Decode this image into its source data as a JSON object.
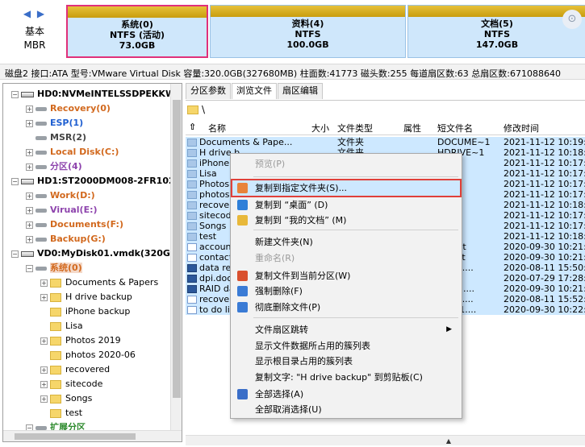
{
  "disk_map": {
    "nav_arrows": "◀ ▶",
    "disk_kind": "基本",
    "disk_style": "MBR",
    "partitions": [
      {
        "name": "系统(0)",
        "fs": "NTFS (活动)",
        "size": "73.0GB"
      },
      {
        "name": "资料(4)",
        "fs": "NTFS",
        "size": "100.0GB"
      },
      {
        "name": "文档(5)",
        "fs": "NTFS",
        "size": "147.0GB"
      }
    ],
    "highlight_color": "#e0307a"
  },
  "info_bar": "磁盘2 接口:ATA  型号:VMware Virtual Disk  容量:320.0GB(327680MB)  柱面数:41773  磁头数:255  每道扇区数:63  总扇区数:671088640",
  "tree": {
    "nodes": [
      {
        "label": "HD0:NVMeINTELSSDPEKKW2",
        "type": "disk",
        "exp": "−"
      },
      {
        "label": "Recovery(0)",
        "type": "part",
        "exp": "+"
      },
      {
        "label": "ESP(1)",
        "type": "part",
        "exp": "+"
      },
      {
        "label": "MSR(2)",
        "type": "part",
        "exp": ""
      },
      {
        "label": "Local Disk(C:)",
        "type": "part",
        "exp": "+"
      },
      {
        "label": "分区(4)",
        "type": "part",
        "exp": "+"
      },
      {
        "label": "HD1:ST2000DM008-2FR102(1",
        "type": "disk",
        "exp": "−"
      },
      {
        "label": "Work(D:)",
        "type": "part",
        "exp": "+"
      },
      {
        "label": "Virual(E:)",
        "type": "part",
        "exp": "+"
      },
      {
        "label": "Documents(F:)",
        "type": "part",
        "exp": "+"
      },
      {
        "label": "Backup(G:)",
        "type": "part",
        "exp": "+"
      },
      {
        "label": "VD0:MyDisk01.vmdk(320GB)",
        "type": "disk",
        "exp": "−"
      },
      {
        "label": "系统(0)",
        "type": "part",
        "exp": "−"
      },
      {
        "label": "Documents & Papers",
        "type": "folder",
        "exp": "+"
      },
      {
        "label": "H drive backup",
        "type": "folder",
        "exp": "+"
      },
      {
        "label": "iPhone backup",
        "type": "folder",
        "exp": ""
      },
      {
        "label": "Lisa",
        "type": "folder",
        "exp": ""
      },
      {
        "label": "Photos 2019",
        "type": "folder",
        "exp": "+"
      },
      {
        "label": "photos 2020-06",
        "type": "folder",
        "exp": ""
      },
      {
        "label": "recovered",
        "type": "folder",
        "exp": "+"
      },
      {
        "label": "sitecode",
        "type": "folder",
        "exp": "+"
      },
      {
        "label": "Songs",
        "type": "folder",
        "exp": "+"
      },
      {
        "label": "test",
        "type": "folder",
        "exp": ""
      },
      {
        "label": "扩展分区",
        "type": "part",
        "exp": "−"
      }
    ]
  },
  "tabs": [
    "分区参数",
    "浏览文件",
    "扇区编辑"
  ],
  "path": "\\",
  "columns": {
    "up": "⇧",
    "name": "名称",
    "size": "大小",
    "type": "文件类型",
    "attr": "属性",
    "short": "短文件名",
    "mtime": "修改时间"
  },
  "files": [
    {
      "name": "Documents & Pape...",
      "type": "文件夹",
      "attr": "",
      "short": "DOCUME~1",
      "mtime": "2021-11-12 10:19:2",
      "icon": "folder"
    },
    {
      "name": "H drive b...",
      "type": "文件夹",
      "attr": "",
      "short": "HDRIVE~1",
      "mtime": "2021-11-12 10:18:3",
      "icon": "folder"
    },
    {
      "name": "iPhone",
      "type": "",
      "attr": "",
      "short": "VE~1",
      "mtime": "2021-11-12 10:17:2",
      "icon": "folder"
    },
    {
      "name": "Lisa",
      "type": "",
      "attr": "",
      "short": "",
      "mtime": "2021-11-12 10:17:4",
      "icon": "folder"
    },
    {
      "name": "Photos",
      "type": "",
      "attr": "",
      "short": "OS~2",
      "mtime": "2021-11-12 10:17:2",
      "icon": "folder"
    },
    {
      "name": "photos",
      "type": "",
      "attr": "",
      "short": "OS~1",
      "mtime": "2021-11-12 10:17:2",
      "icon": "folder"
    },
    {
      "name": "recover",
      "type": "",
      "attr": "",
      "short": "VE~1",
      "mtime": "2021-11-12 10:18:3",
      "icon": "folder"
    },
    {
      "name": "sitecod",
      "type": "",
      "attr": "",
      "short": "de",
      "mtime": "2021-11-12 10:17:4",
      "icon": "folder"
    },
    {
      "name": "Songs",
      "type": "",
      "attr": "",
      "short": "s",
      "mtime": "2021-11-12 10:17:3",
      "icon": "folder"
    },
    {
      "name": "test",
      "type": "",
      "attr": "",
      "short": "",
      "mtime": "2021-11-12 10:18:2",
      "icon": "folder"
    },
    {
      "name": "account",
      "type": "",
      "attr": "",
      "short": "nts.txt",
      "mtime": "2020-09-30 10:21:0",
      "icon": "file"
    },
    {
      "name": "contact",
      "type": "",
      "attr": "",
      "short": "cts.txt",
      "mtime": "2020-09-30 10:21:0",
      "icon": "file"
    },
    {
      "name": "data re",
      "type": "",
      "attr": "",
      "short": "RE~1....",
      "mtime": "2020-08-11 15:50:2",
      "icon": "doc"
    },
    {
      "name": "dpi.doc",
      "type": "",
      "attr": "",
      "short": ".DOC",
      "mtime": "2020-07-29 17:28:3",
      "icon": "doc"
    },
    {
      "name": "RAID da",
      "type": "",
      "attr": "",
      "short": "DA~1....",
      "mtime": "2020-09-30 10:21:5",
      "icon": "doc"
    },
    {
      "name": "recover",
      "type": "",
      "attr": "",
      "short": "VE~1....",
      "mtime": "2020-08-11 15:52:5",
      "icon": "file"
    },
    {
      "name": "to do li",
      "type": "",
      "attr": "",
      "short": "OLI~1....",
      "mtime": "2020-09-30 10:22:2",
      "icon": "file"
    }
  ],
  "context_menu": {
    "items": [
      {
        "label": "预览(P)",
        "disabled": true,
        "icon": ""
      },
      {
        "label": "复制到指定文件夹(S)...",
        "highlight": true,
        "icon": "copy-folder-icon",
        "icon_color": "#e8833a"
      },
      {
        "label": "复制到 “桌面” (D)",
        "icon": "desktop-icon",
        "icon_color": "#2f7fd8"
      },
      {
        "label": "复制到 “我的文档” (M)",
        "icon": "documents-icon",
        "icon_color": "#e8b83a"
      },
      {
        "label": "新建文件夹(N)",
        "icon": ""
      },
      {
        "label": "重命名(R)",
        "disabled": true,
        "icon": ""
      },
      {
        "label": "复制文件到当前分区(W)",
        "icon": "copy-partition-icon",
        "icon_color": "#d9502e"
      },
      {
        "label": "强制删除(F)",
        "icon": "force-delete-icon",
        "icon_color": "#3a7bd5"
      },
      {
        "label": "彻底删除文件(P)",
        "icon": "wipe-icon",
        "icon_color": "#3a7bd5"
      },
      {
        "label": "文件扇区跳转",
        "submenu": true,
        "icon": ""
      },
      {
        "label": "显示文件数据所占用的簇列表",
        "icon": ""
      },
      {
        "label": "显示根目录占用的簇列表",
        "icon": ""
      },
      {
        "label": "复制文字: \"H drive backup\" 到剪贴板(C)",
        "icon": ""
      },
      {
        "label": "全部选择(A)",
        "icon": "checkbox-icon",
        "icon_color": "#3a6ec8"
      },
      {
        "label": "全部取消选择(U)",
        "icon": ""
      }
    ],
    "submenu_arrow": "▶"
  },
  "list_scroll_arrow": "▲"
}
